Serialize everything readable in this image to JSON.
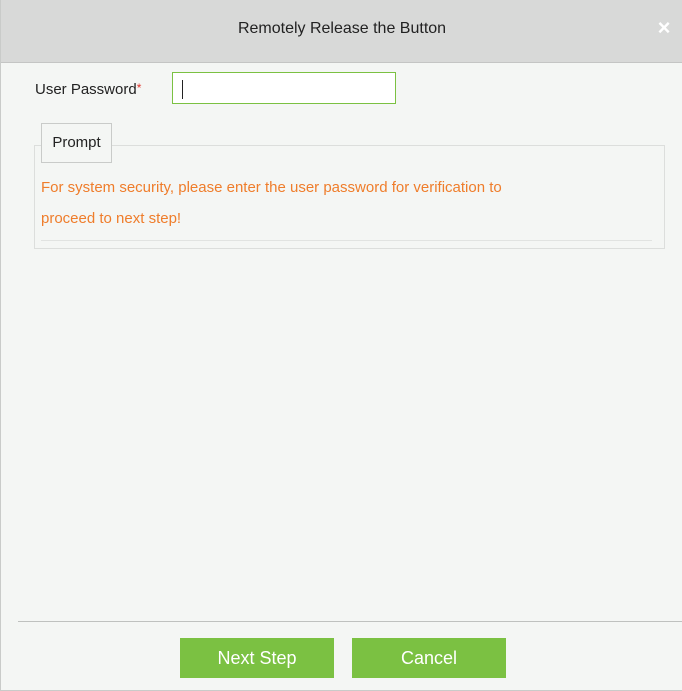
{
  "dialog": {
    "title": "Remotely Release the Button",
    "close_icon": "close-icon",
    "close_glyph": "×"
  },
  "form": {
    "password_label": "User Password",
    "required_mark": "*",
    "password_value": "",
    "password_placeholder": ""
  },
  "prompt": {
    "legend": "Prompt",
    "message_line1": "For system security, please enter the user password for verification to",
    "message_line2": "proceed to next step!",
    "message_color": "#ef7d2b"
  },
  "footer": {
    "next_label": "Next Step",
    "cancel_label": "Cancel"
  },
  "colors": {
    "accent": "#7bc142",
    "titlebar": "#d8d9d8",
    "background": "#f4f6f4",
    "required": "#e0332a"
  }
}
